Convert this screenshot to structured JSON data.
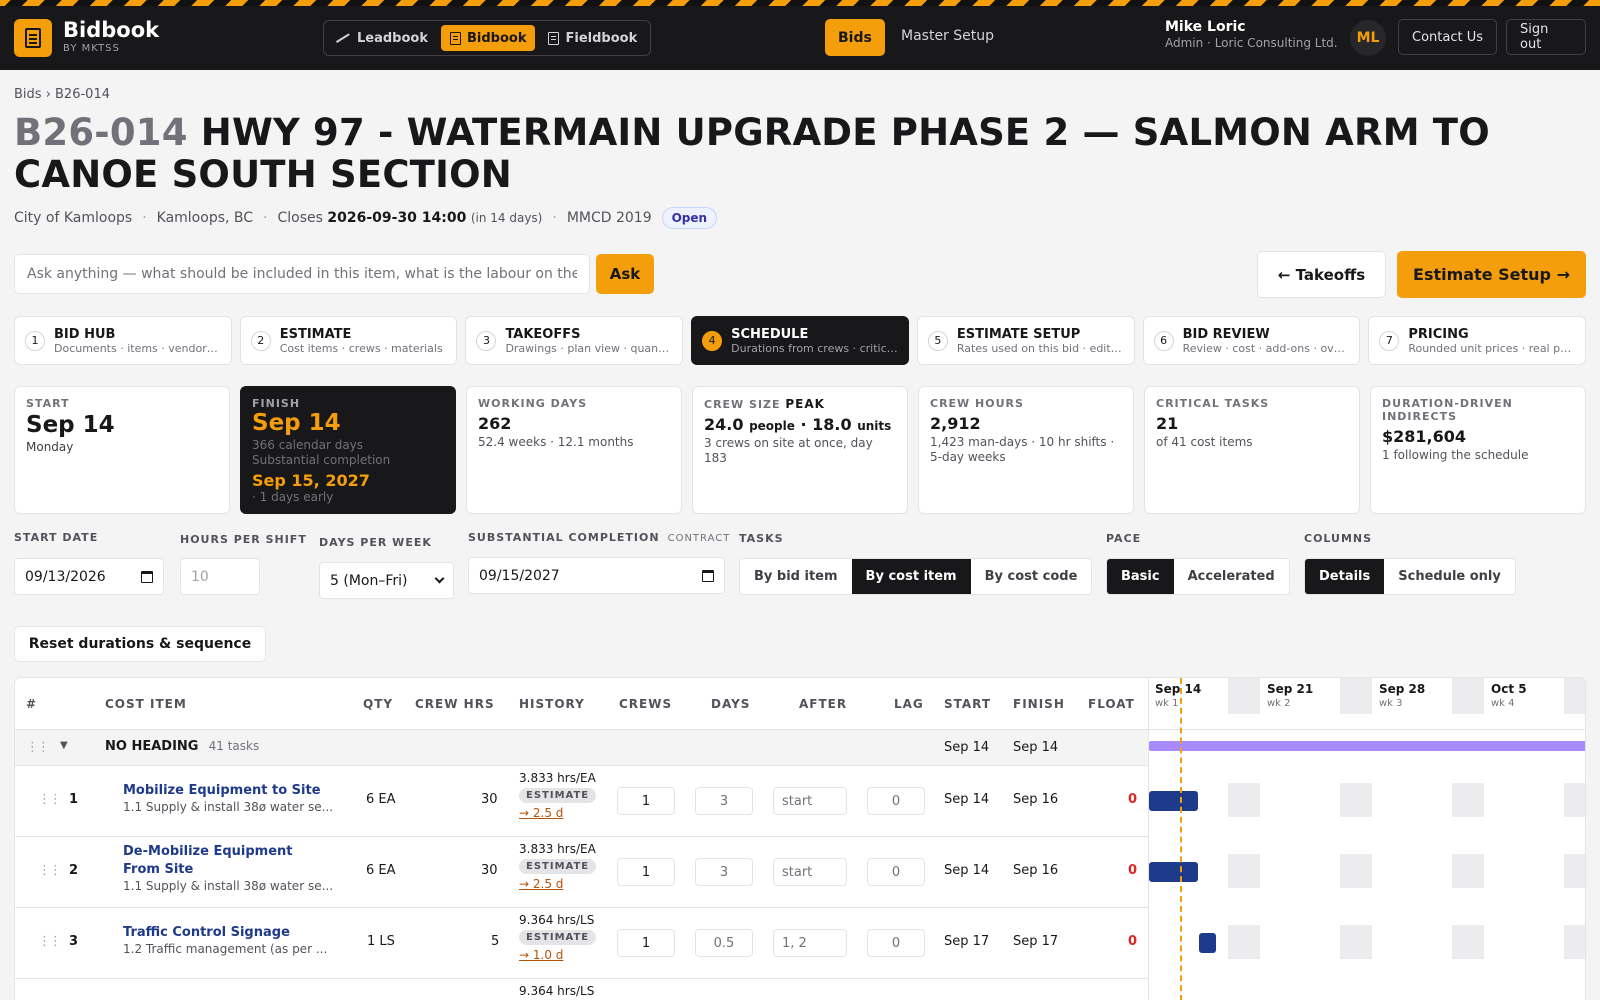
{
  "header": {
    "brand_name": "Bidbook",
    "brand_sub": "BY MKTSS",
    "apps": [
      {
        "label": "Leadbook",
        "icon": "trend-icon"
      },
      {
        "label": "Bidbook",
        "icon": "document-icon"
      },
      {
        "label": "Fieldbook",
        "icon": "document-icon"
      }
    ],
    "nav_bids": "Bids",
    "nav_master": "Master Setup",
    "user_name": "Mike Loric",
    "user_role": "Admin · Loric Consulting Ltd.",
    "avatar_initials": "ML",
    "contact_label": "Contact Us",
    "signout_label": "Sign out",
    "accent_color": "#f59e0b"
  },
  "page": {
    "breadcrumb": "Bids › B26-014",
    "bid_code": "B26-014",
    "bid_title": "HWY 97 - WATERMAIN UPGRADE PHASE 2 — SALMON ARM TO CANOE SOUTH SECTION",
    "owner": "City of Kamloops",
    "location": "Kamloops, BC",
    "closes_label": "Closes",
    "closes_value": "2026-09-30 14:00",
    "closes_note": "(in 14 days)",
    "spec": "MMCD 2019",
    "status": "Open"
  },
  "ask": {
    "placeholder": "Ask anything — what should be included in this item, what is the labour on the work",
    "button": "Ask"
  },
  "actions": {
    "back": "← Takeoffs",
    "next": "Estimate Setup →"
  },
  "steps": [
    {
      "num": "1",
      "title": "BID HUB",
      "sub": "Documents · items · vendor quotes"
    },
    {
      "num": "2",
      "title": "ESTIMATE",
      "sub": "Cost items · crews · materials"
    },
    {
      "num": "3",
      "title": "TAKEOFFS",
      "sub": "Drawings · plan view · quantities"
    },
    {
      "num": "4",
      "title": "SCHEDULE",
      "sub": "Durations from crews · critical path"
    },
    {
      "num": "5",
      "title": "ESTIMATE SETUP",
      "sub": "Rates used on this bid · editable"
    },
    {
      "num": "6",
      "title": "BID REVIEW",
      "sub": "Review · cost · add-ons · overheads"
    },
    {
      "num": "7",
      "title": "PRICING",
      "sub": "Rounded unit prices · real pricing"
    }
  ],
  "stats": {
    "start": {
      "label": "START",
      "value": "Sep 14",
      "sub": "Monday"
    },
    "finish": {
      "label": "FINISH",
      "value": "Sep 14",
      "sub1": "366 calendar days",
      "sub2": "Substantial completion",
      "completion": "Sep 15, 2027",
      "early": "· 1 days early"
    },
    "working_days": {
      "label": "WORKING DAYS",
      "value": "262",
      "sub": "52.4 weeks · 12.1 months"
    },
    "crew_size": {
      "label": "CREW SIZE",
      "peak": "PEAK",
      "people": "24.0",
      "people_unit": "people",
      "sep": "·",
      "units": "18.0",
      "units_unit": "units",
      "sub": "3 crews on site at once, day 183"
    },
    "crew_hours": {
      "label": "CREW HOURS",
      "value": "2,912",
      "sub": "1,423 man-days · 10 hr shifts · 5-day weeks"
    },
    "critical": {
      "label": "CRITICAL TASKS",
      "value": "21",
      "sub": "of 41 cost items"
    },
    "indirects": {
      "label": "DURATION-DRIVEN INDIRECTS",
      "value": "$281,604",
      "sub": "1 following the schedule"
    }
  },
  "controls": {
    "start_date_label": "START DATE",
    "start_date": "09/13/2026",
    "hours_label": "HOURS PER SHIFT",
    "hours_placeholder": "10",
    "days_label": "DAYS PER WEEK",
    "days_value": "5 (Mon–Fri)",
    "completion_label": "SUBSTANTIAL COMPLETION",
    "completion_tag": "CONTRACT",
    "completion_date": "09/15/2027",
    "tasks_label": "TASKS",
    "tasks_options": [
      "By bid item",
      "By cost item",
      "By cost code"
    ],
    "tasks_selected": 1,
    "pace_label": "PACE",
    "pace_options": [
      "Basic",
      "Accelerated"
    ],
    "pace_selected": 0,
    "columns_label": "COLUMNS",
    "columns_options": [
      "Details",
      "Schedule only"
    ],
    "columns_selected": 0,
    "reset_label": "Reset durations & sequence"
  },
  "table": {
    "headers": {
      "num": "#",
      "item": "COST ITEM",
      "qty": "QTY",
      "crew_hrs": "CREW HRS",
      "history": "HISTORY",
      "crews": "CREWS",
      "days": "DAYS",
      "after": "AFTER",
      "lag": "LAG",
      "start": "START",
      "finish": "FINISH",
      "float": "FLOAT"
    },
    "group": {
      "name": "NO HEADING",
      "count": "41 tasks",
      "start": "Sep 14",
      "finish": "Sep 14"
    },
    "rows": [
      {
        "num": "1",
        "name1": "Mobilize Equipment to Site",
        "name2": "",
        "sub": "1.1 Supply & install 38ø water se...",
        "qty": "6 EA",
        "crew_hrs": "30",
        "rate": "3.833 hrs/EA",
        "badge": "ESTIMATE",
        "link": "→ 2.5 d",
        "crews": "1",
        "days": "3",
        "after": "start",
        "lag": "0",
        "start": "Sep 14",
        "finish": "Sep 16",
        "float": "0"
      },
      {
        "num": "2",
        "name1": "De-Mobilize Equipment",
        "name2": "From Site",
        "sub": "1.1 Supply & install 38ø water se...",
        "qty": "6 EA",
        "crew_hrs": "30",
        "rate": "3.833 hrs/EA",
        "badge": "ESTIMATE",
        "link": "→ 2.5 d",
        "crews": "1",
        "days": "3",
        "after": "start",
        "lag": "0",
        "start": "Sep 14",
        "finish": "Sep 16",
        "float": "0"
      },
      {
        "num": "3",
        "name1": "Traffic Control Signage",
        "name2": "",
        "sub": "1.2 Traffic management (as per ...",
        "qty": "1 LS",
        "crew_hrs": "5",
        "rate": "9.364 hrs/LS",
        "badge": "ESTIMATE",
        "link": "→ 1.0 d",
        "crews": "1",
        "days": "0.5",
        "after": "1, 2",
        "lag": "0",
        "start": "Sep 17",
        "finish": "Sep 17",
        "float": "0"
      },
      {
        "num": "",
        "name1": "",
        "name2": "",
        "sub": "",
        "qty": "",
        "crew_hrs": "",
        "rate": "9.364 hrs/LS",
        "badge": "",
        "link": "",
        "crews": "",
        "days": "",
        "after": "",
        "lag": "",
        "start": "",
        "finish": "",
        "float": ""
      }
    ]
  },
  "gantt": {
    "weeks": [
      {
        "date": "Sep 14",
        "wk": "wk 1"
      },
      {
        "date": "Sep 21",
        "wk": "wk 2"
      },
      {
        "date": "Sep 28",
        "wk": "wk 3"
      },
      {
        "date": "Oct 5",
        "wk": "wk 4"
      }
    ],
    "group_bar_color": "#a78bfa",
    "task_bar_color": "#1e3a8a",
    "today_color": "#f59e0b"
  }
}
